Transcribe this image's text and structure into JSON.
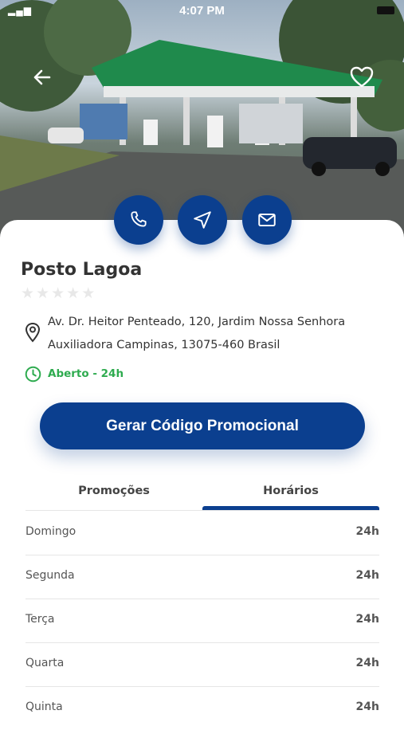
{
  "status_bar": {
    "time": "4:07 PM"
  },
  "station": {
    "name": "Posto Lagoa",
    "rating_stars": 0,
    "address_line1": "Av. Dr. Heitor Penteado, 120, Jardim Nossa Senhora",
    "address_line2": "Auxiliadora Campinas, 13075-460 Brasil",
    "open_status": "Aberto - 24h"
  },
  "actions": {
    "icons": [
      "phone-icon",
      "navigate-icon",
      "mail-icon"
    ]
  },
  "promo_button": {
    "label": "Gerar Código Promocional"
  },
  "tabs": [
    {
      "label": "Promoções",
      "active": false
    },
    {
      "label": "Horários",
      "active": true
    }
  ],
  "hours": [
    {
      "day": "Domingo",
      "time": "24h"
    },
    {
      "day": "Segunda",
      "time": "24h"
    },
    {
      "day": "Terça",
      "time": "24h"
    },
    {
      "day": "Quarta",
      "time": "24h"
    },
    {
      "day": "Quinta",
      "time": "24h"
    }
  ],
  "colors": {
    "primary": "#0b3f8f",
    "open_green": "#2eab4f"
  }
}
